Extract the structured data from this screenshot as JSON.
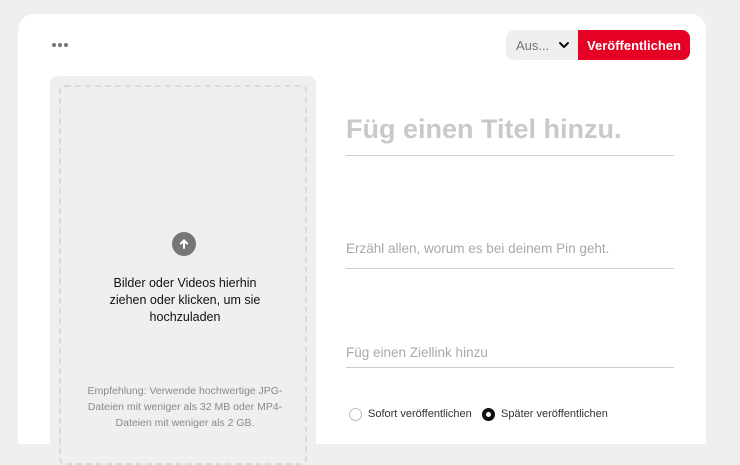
{
  "header": {
    "more_icon": "more-horizontal-icon",
    "board_select": {
      "value": "Aus...",
      "icon": "chevron-down-icon"
    },
    "publish_label": "Veröffentlichen",
    "accent_color": "#e60023"
  },
  "upload": {
    "icon": "upload-arrow-icon",
    "lines": [
      "Bilder oder Videos hierhin",
      "ziehen oder klicken, um sie",
      "hochzuladen"
    ],
    "hint_lines": [
      "Empfehlung: Verwende hochwertige JPG-",
      "Dateien mit weniger als 32 MB oder MP4-",
      "Dateien mit weniger als 2 GB."
    ]
  },
  "form": {
    "title_placeholder": "Füg einen Titel hinzu.",
    "description_placeholder": "Erzähl allen, worum es bei deinem Pin geht.",
    "link_placeholder": "Füg einen Ziellink hinzu"
  },
  "publish_timing": {
    "now_label": "Sofort veröffentlichen",
    "later_label": "Später veröffentlichen",
    "selected": "later"
  }
}
